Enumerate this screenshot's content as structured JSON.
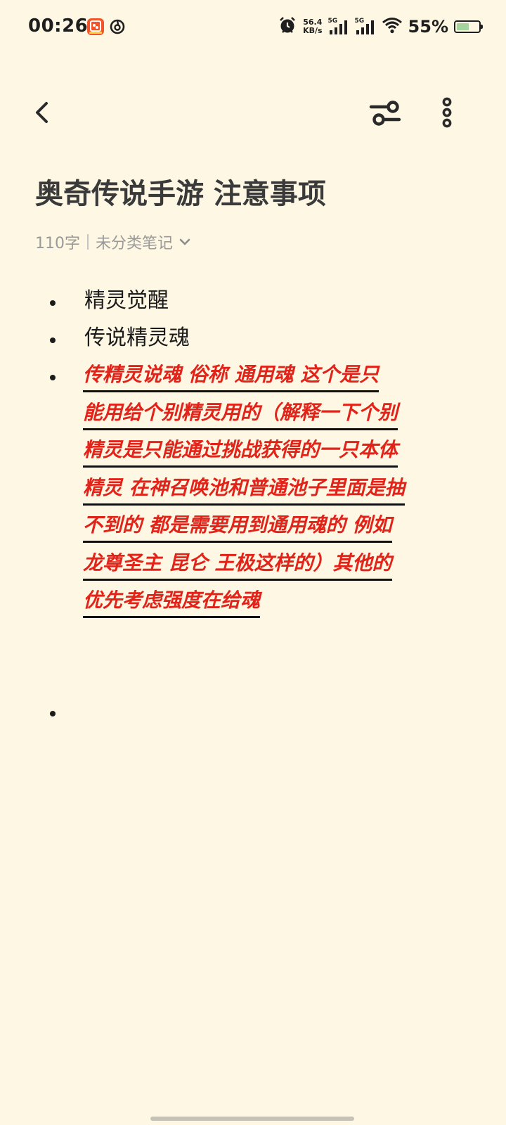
{
  "status_bar": {
    "time": "00:26",
    "net_speed_value": "56.4",
    "net_speed_unit": "KB/s",
    "sim1_label": "5G",
    "sim2_label": "5G",
    "battery_percent": "55%",
    "battery_level": 0.55,
    "icons": [
      "app-icon",
      "netease-music-icon",
      "alarm-icon",
      "signal-icon",
      "signal-icon",
      "wifi-icon",
      "battery-icon"
    ]
  },
  "toolbar": {
    "icons": [
      "back-arrow-icon",
      "filter-sliders-icon",
      "more-vertical-icon"
    ]
  },
  "note": {
    "title": "奥奇传说手游 注意事项",
    "char_count": "110字",
    "category": "未分类笔记",
    "items": [
      "精灵觉醒",
      "传说精灵魂"
    ],
    "highlight_lines": [
      "传精灵说魂  俗称  通用魂  这个是只",
      "能用给个别精灵用的（解释一下个别",
      "精灵是只能通过挑战获得的一只本体",
      "精灵 在神召唤池和普通池子里面是抽",
      "不到的 都是需要用到通用魂的 例如",
      "龙尊圣主  昆仑  王极这样的）其他的",
      "优先考虑强度在给魂"
    ],
    "highlight_color": "#e2231a"
  }
}
